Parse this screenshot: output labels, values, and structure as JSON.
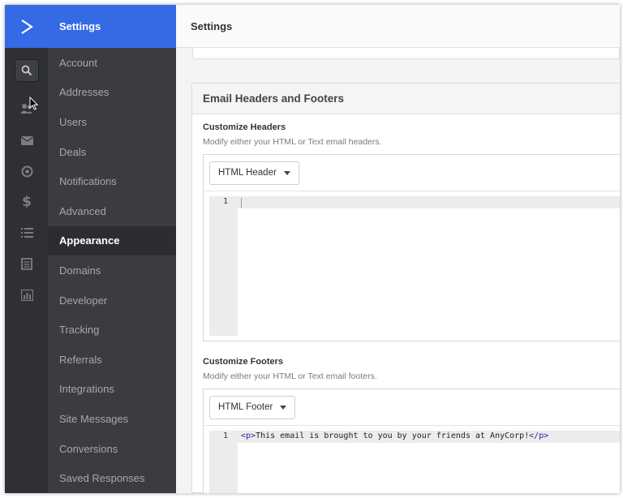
{
  "rail": {
    "icons": [
      "search-icon",
      "contacts-icon",
      "mail-icon",
      "target-icon",
      "dollar-icon",
      "list-icon",
      "document-icon",
      "bar-chart-icon"
    ]
  },
  "nav": {
    "title": "Settings",
    "items": [
      {
        "label": "Account"
      },
      {
        "label": "Addresses"
      },
      {
        "label": "Users"
      },
      {
        "label": "Deals"
      },
      {
        "label": "Notifications"
      },
      {
        "label": "Advanced"
      },
      {
        "label": "Appearance",
        "active": true
      },
      {
        "label": "Domains"
      },
      {
        "label": "Developer"
      },
      {
        "label": "Tracking"
      },
      {
        "label": "Referrals"
      },
      {
        "label": "Integrations"
      },
      {
        "label": "Site Messages"
      },
      {
        "label": "Conversions"
      },
      {
        "label": "Saved Responses"
      }
    ]
  },
  "header": {
    "title": "Settings"
  },
  "panel": {
    "title": "Email Headers and Footers",
    "headers": {
      "title": "Customize Headers",
      "description": "Modify either your HTML or Text email headers.",
      "dropdown": "HTML Header",
      "line_number": "1",
      "code": ""
    },
    "footers": {
      "title": "Customize Footers",
      "description": "Modify either your HTML or Text email footers.",
      "dropdown": "HTML Footer",
      "line_number": "1",
      "code_open_tag": "<p>",
      "code_text": "This email is brought to you by your friends at AnyCorp!",
      "code_close_tag": "</p>"
    }
  },
  "colors": {
    "brand_blue": "#356ae6",
    "rail_bg": "#2f3033",
    "nav_bg": "#3b3c3f",
    "nav_active_bg": "#2c2d30"
  }
}
